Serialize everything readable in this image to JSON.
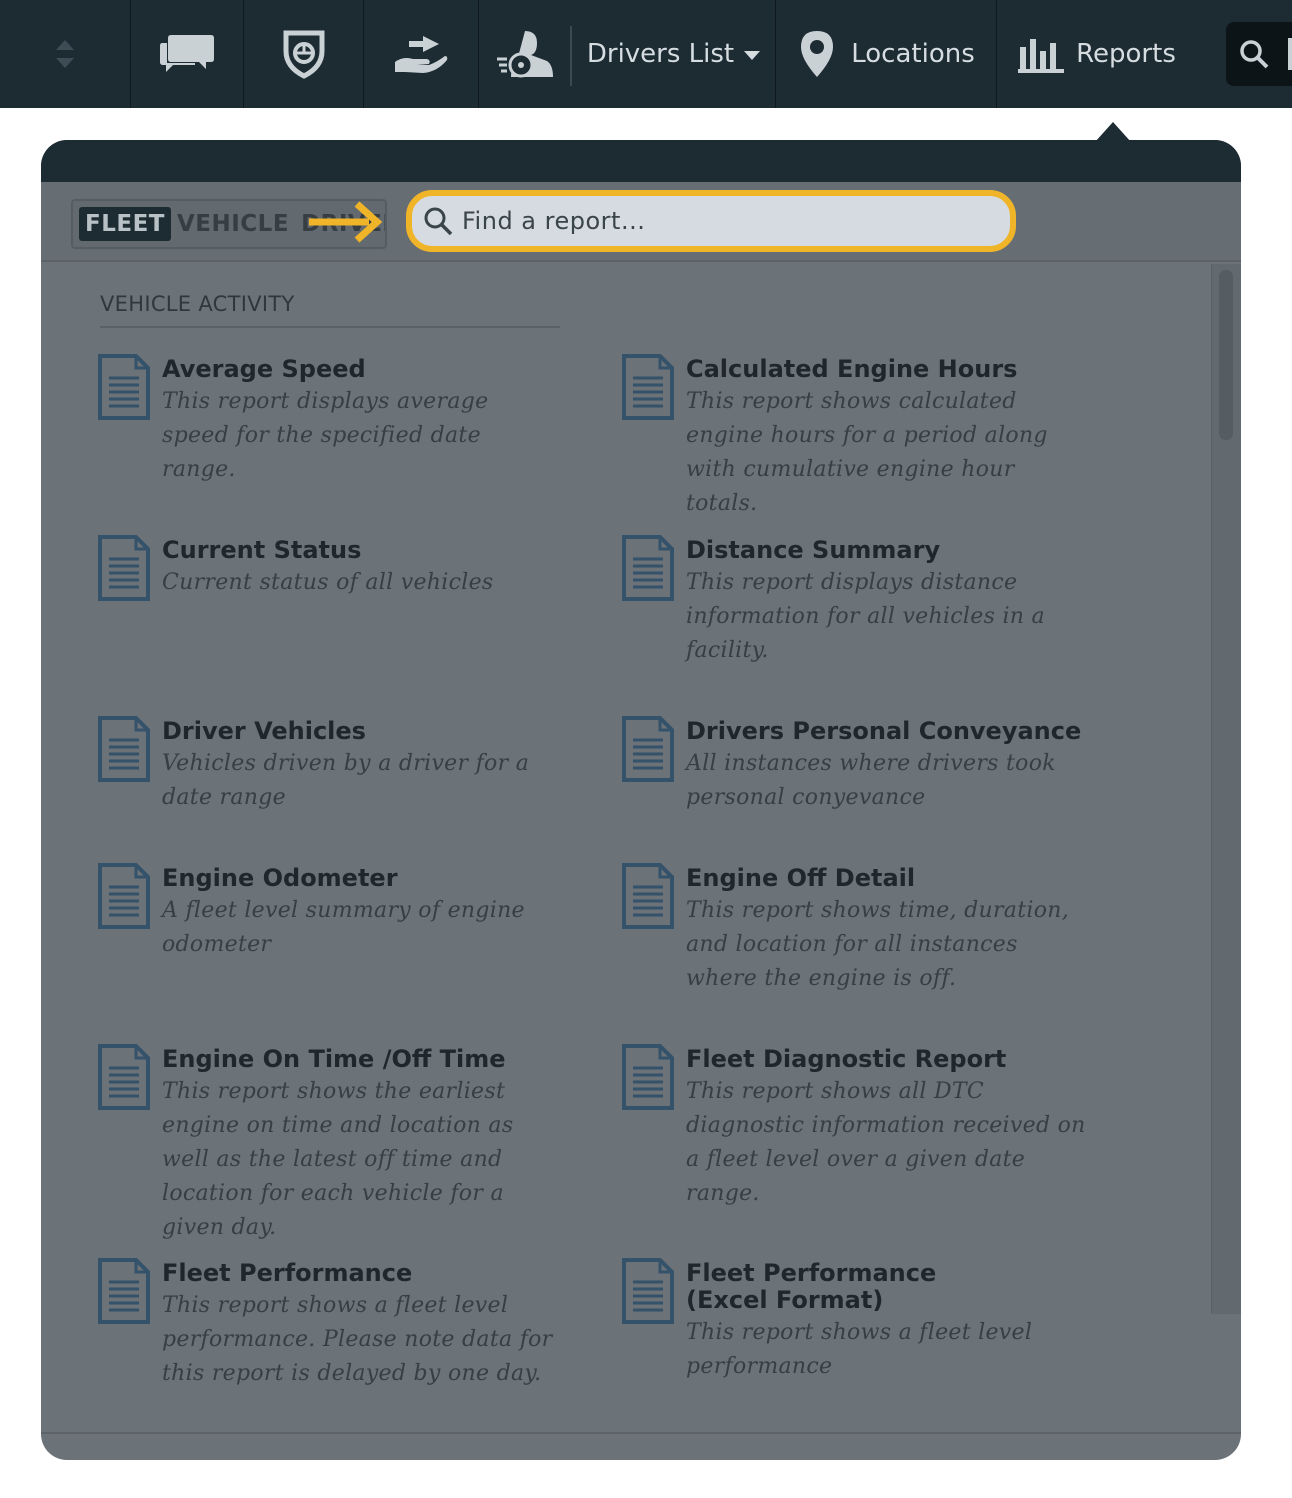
{
  "nav": {
    "drivers_list_label": "Drivers List",
    "locations_label": "Locations",
    "reports_label": "Reports",
    "icons": [
      "sort-icon",
      "chat-icon",
      "shield-icon",
      "hand-transfer-icon",
      "driver-wheel-icon",
      "map-pin-icon",
      "bar-chart-icon",
      "search-icon"
    ]
  },
  "tabs": {
    "fleet": "FLEET",
    "vehicle": "VEHICLE",
    "driver": "DRIVER"
  },
  "search": {
    "placeholder": "Find a report..."
  },
  "section": {
    "title": "VEHICLE ACTIVITY"
  },
  "reports": [
    {
      "title": "Average Speed",
      "desc": "This report displays average speed for the specified date range."
    },
    {
      "title": "Calculated Engine Hours",
      "desc": "This report shows calculated engine hours for a period along with cumulative engine hour totals."
    },
    {
      "title": "Current Status",
      "desc": "Current status of all vehicles"
    },
    {
      "title": "Distance Summary",
      "desc": "This report displays distance information for all vehicles in a facility."
    },
    {
      "title": "Driver Vehicles",
      "desc": "Vehicles driven by a driver for a date range"
    },
    {
      "title": "Drivers Personal Conveyance",
      "desc": "All instances where drivers took personal conyevance"
    },
    {
      "title": "Engine Odometer",
      "desc": "A fleet level summary of engine odometer"
    },
    {
      "title": "Engine Off Detail",
      "desc": "This report shows time, duration, and location for all instances where the engine is off."
    },
    {
      "title": "Engine On Time /Off Time",
      "desc": "This report shows the earliest engine on time and location as well as the latest off time and location for each vehicle for a given day."
    },
    {
      "title": "Fleet Diagnostic Report",
      "desc": "This report shows all DTC diagnostic information received on a fleet level over a given date range."
    },
    {
      "title": "Fleet Performance",
      "desc": "This report shows a fleet level performance. Please note data for this report is delayed by one day."
    },
    {
      "title": "Fleet Performance (Excel Format)",
      "desc": "This report shows a fleet level performance"
    }
  ],
  "colors": {
    "nav_bg": "#1d2b33",
    "overlay_bg": "#6b7278",
    "highlight": "#f0b429"
  }
}
